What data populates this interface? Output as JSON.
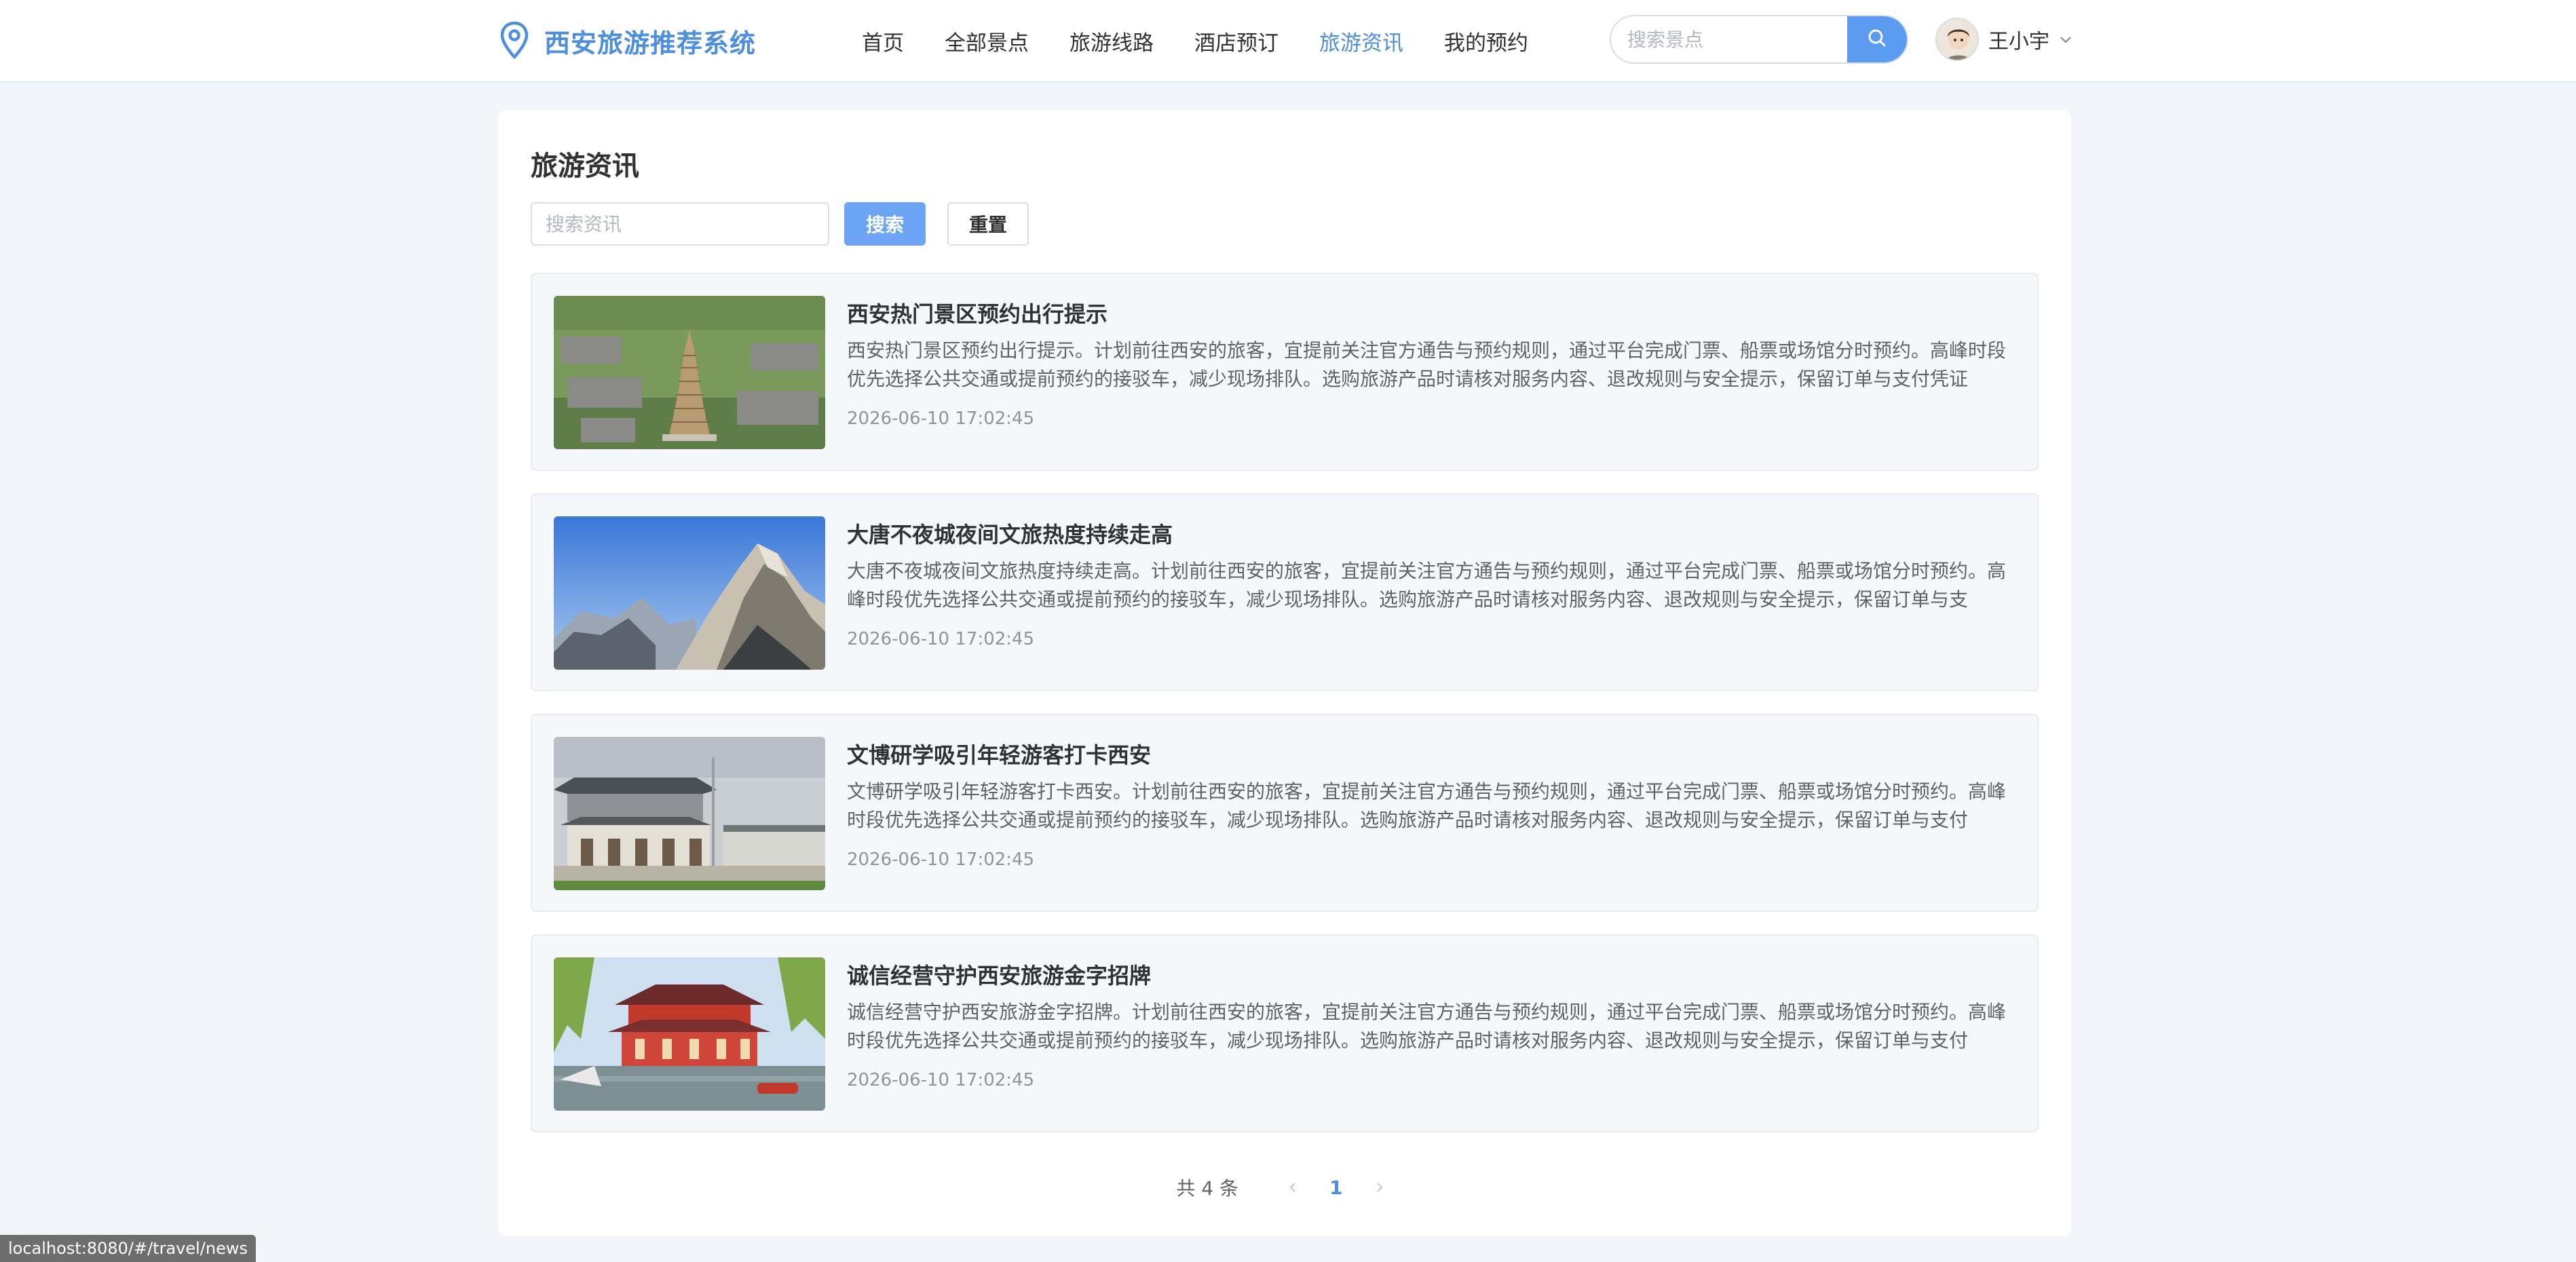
{
  "header": {
    "logo_text": "西安旅游推荐系统",
    "nav": [
      {
        "label": "首页",
        "active": false
      },
      {
        "label": "全部景点",
        "active": false
      },
      {
        "label": "旅游线路",
        "active": false
      },
      {
        "label": "酒店预订",
        "active": false
      },
      {
        "label": "旅游资讯",
        "active": true
      },
      {
        "label": "我的预约",
        "active": false
      }
    ],
    "search_placeholder": "搜索景点",
    "user_name": "王小宇"
  },
  "page": {
    "title": "旅游资讯",
    "search_placeholder": "搜索资讯",
    "search_button": "搜索",
    "reset_button": "重置"
  },
  "news": [
    {
      "title": "西安热门景区预约出行提示",
      "summary": "西安热门景区预约出行提示。计划前往西安的旅客，宜提前关注官方通告与预约规则，通过平台完成门票、船票或场馆分时预约。高峰时段优先选择公共交通或提前预约的接驳车，减少现场排队。选购旅游产品时请核对服务内容、退改规则与安全提示，保留订单与支付凭证",
      "date": "2026-06-10 17:02:45",
      "image": "pagoda"
    },
    {
      "title": "大唐不夜城夜间文旅热度持续走高",
      "summary": "大唐不夜城夜间文旅热度持续走高。计划前往西安的旅客，宜提前关注官方通告与预约规则，通过平台完成门票、船票或场馆分时预约。高峰时段优先选择公共交通或提前预约的接驳车，减少现场排队。选购旅游产品时请核对服务内容、退改规则与安全提示，保留订单与支",
      "date": "2026-06-10 17:02:45",
      "image": "mountain"
    },
    {
      "title": "文博研学吸引年轻游客打卡西安",
      "summary": "文博研学吸引年轻游客打卡西安。计划前往西安的旅客，宜提前关注官方通告与预约规则，通过平台完成门票、船票或场馆分时预约。高峰时段优先选择公共交通或提前预约的接驳车，减少现场排队。选购旅游产品时请核对服务内容、退改规则与安全提示，保留订单与支付",
      "date": "2026-06-10 17:02:45",
      "image": "museum"
    },
    {
      "title": "诚信经营守护西安旅游金字招牌",
      "summary": "诚信经营守护西安旅游金字招牌。计划前往西安的旅客，宜提前关注官方通告与预约规则，通过平台完成门票、船票或场馆分时预约。高峰时段优先选择公共交通或提前预约的接驳车，减少现场排队。选购旅游产品时请核对服务内容、退改规则与安全提示，保留订单与支付",
      "date": "2026-06-10 17:02:45",
      "image": "pavilion"
    }
  ],
  "pagination": {
    "total_text": "共 4 条",
    "current_page": "1"
  },
  "status_bar": {
    "url": "localhost:8080/#/travel/news"
  },
  "colors": {
    "accent": "#4d8fdc",
    "primary_button": "#6aa4f3",
    "page_background": "#f2f6fb"
  }
}
